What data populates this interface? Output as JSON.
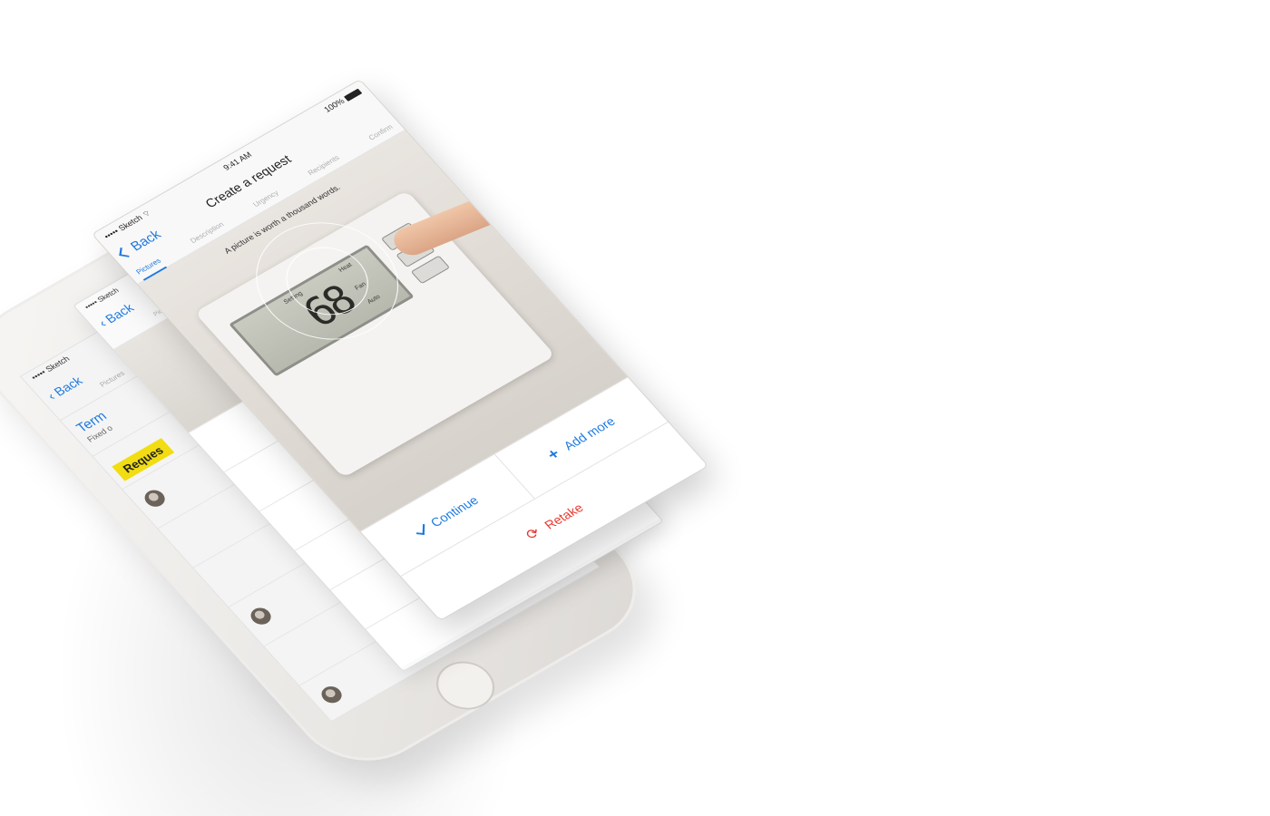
{
  "phone": {
    "status_carrier": "••••• Sketch",
    "back_label": "Back",
    "tab_pictures": "Pictures",
    "term_label": "Term",
    "fixed_label": "Fixed o",
    "request_badge": "Reques"
  },
  "middle_card": {
    "status_carrier": "••••• Sketch",
    "back_label": "Back",
    "tab_pictures": "Pictures",
    "add_symbol": "+"
  },
  "camera_screen": {
    "status": {
      "carrier": "••••• Sketch",
      "wifi_icon": "wifi-icon",
      "time": "9:41 AM",
      "battery": "100%"
    },
    "nav": {
      "back_label": "Back",
      "title": "Create a request"
    },
    "tabs": [
      {
        "label": "Pictures",
        "active": true
      },
      {
        "label": "Description",
        "active": false
      },
      {
        "label": "Urgency",
        "active": false
      },
      {
        "label": "Recipients",
        "active": false
      },
      {
        "label": "Confirm",
        "active": false
      }
    ],
    "hint": "A picture is worth a thousand words.",
    "thermostat": {
      "display_temp": "68",
      "lcd_labels": [
        "Setting",
        "Heat",
        "Fan",
        "Auto"
      ]
    },
    "actions": {
      "continue_label": "Continue",
      "add_more_label": "Add more",
      "retake_label": "Retake"
    }
  },
  "colors": {
    "accent": "#1f7ae0",
    "danger": "#e8392d",
    "badge_yellow": "#f1dd12"
  }
}
